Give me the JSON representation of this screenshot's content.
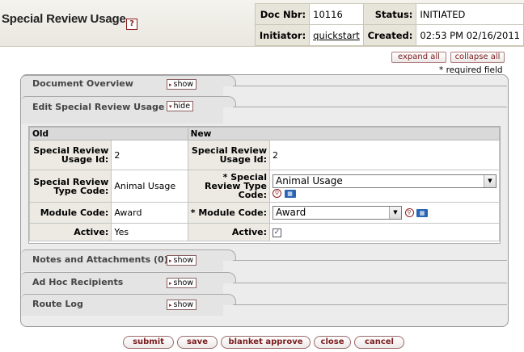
{
  "header": {
    "title": "Special Review Usage",
    "help_icon": "?",
    "doc_nbr_label": "Doc Nbr:",
    "doc_nbr": "10116",
    "status_label": "Status:",
    "status": "INITIATED",
    "initiator_label": "Initiator:",
    "initiator": "quickstart",
    "created_label": "Created:",
    "created": "02:53 PM 02/16/2011"
  },
  "controls": {
    "expand_all": "expand all",
    "collapse_all": "collapse all",
    "required_note": "* required field"
  },
  "tabs": {
    "document_overview": {
      "label": "Document Overview",
      "toggle": "show"
    },
    "edit_special_review_usage": {
      "label": "Edit Special Review Usage",
      "toggle": "hide"
    },
    "notes": {
      "label": "Notes and Attachments (0)",
      "toggle": "show"
    },
    "adhoc": {
      "label": "Ad Hoc Recipients",
      "toggle": "show"
    },
    "route_log": {
      "label": "Route Log",
      "toggle": "show"
    }
  },
  "maintenance": {
    "old_header": "Old",
    "new_header": "New",
    "rows": {
      "id": {
        "label": "Special Review Usage Id:",
        "old": "2",
        "new": "2"
      },
      "type": {
        "label": "Special Review Type Code:",
        "required_label": "* Special Review Type Code:",
        "old": "Animal Usage",
        "new": "Animal Usage"
      },
      "module": {
        "label": "Module Code:",
        "required_label": "* Module Code:",
        "old": "Award",
        "new": "Award"
      },
      "active": {
        "label": "Active:",
        "old": "Yes",
        "new_checked": "✓"
      }
    }
  },
  "icons": {
    "lookup": "lookup-icon",
    "inquiry": "direct-inquiry-icon",
    "triangle_right": "▸",
    "triangle_down": "▾",
    "dropdown": "▼"
  },
  "buttons": {
    "submit": "submit",
    "save": "save",
    "blanket_approve": "blanket approve",
    "close": "close",
    "cancel": "cancel"
  }
}
